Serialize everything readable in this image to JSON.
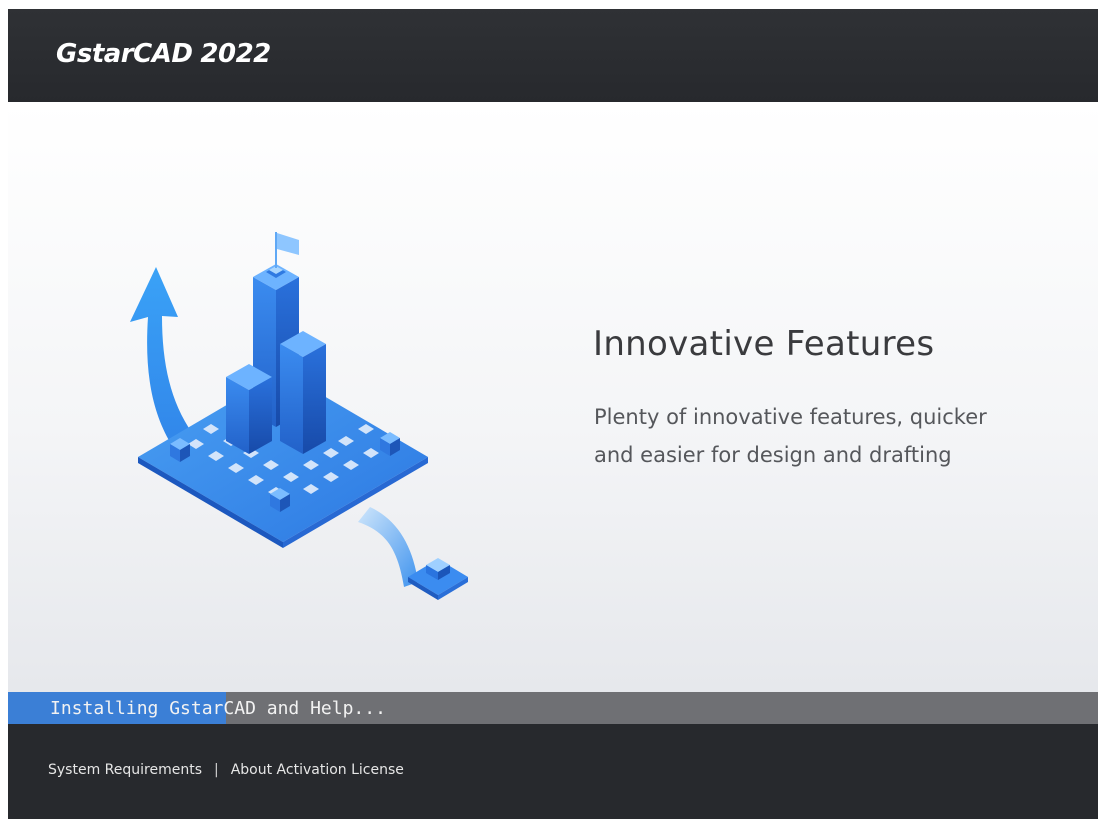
{
  "header": {
    "brand": "GstarCAD",
    "version": "2022"
  },
  "feature": {
    "title": "Innovative Features",
    "description": "Plenty of innovative features, quicker and easier for design and drafting",
    "illustration_icon": "isometric-city-growth-icon"
  },
  "progress": {
    "status": "Installing GstarCAD and Help...",
    "fraction": 0.2
  },
  "footer": {
    "links": [
      {
        "label": "System Requirements"
      },
      {
        "label": "About Activation License"
      }
    ],
    "separator": "|"
  },
  "colors": {
    "header_bg": "#2b2d31",
    "accent_blue": "#3b7fd6",
    "progress_track": "#6f7074",
    "title_text": "#3a3b3e"
  }
}
